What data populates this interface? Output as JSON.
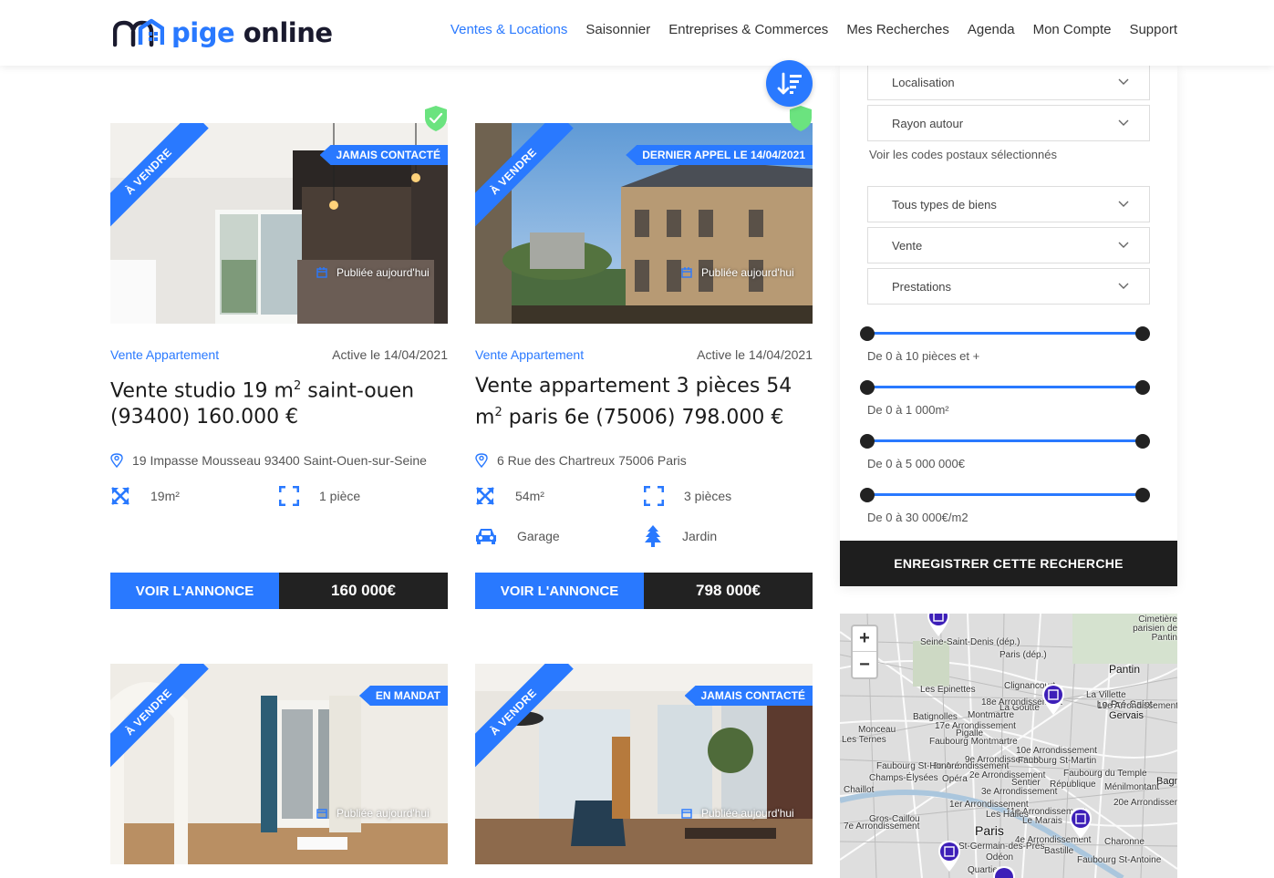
{
  "brand": {
    "part1": "pige",
    "part2": "online"
  },
  "nav": {
    "items": [
      {
        "label": "Ventes & Locations",
        "active": true
      },
      {
        "label": "Saisonnier"
      },
      {
        "label": "Entreprises & Commerces"
      },
      {
        "label": "Mes Recherches"
      },
      {
        "label": "Agenda"
      },
      {
        "label": "Mon Compte"
      },
      {
        "label": "Support"
      }
    ]
  },
  "colors": {
    "accent": "#2979ff",
    "dark": "#222222",
    "shield": "#6be37f"
  },
  "listings": [
    {
      "ribbon": "À VENDRE",
      "status": "JAMAIS CONTACTÉ",
      "published": "Publiée aujourd'hui",
      "type": "Vente Appartement",
      "active": "Active le 14/04/2021",
      "title_a": "Vente studio 19 m",
      "title_sup": "2",
      "title_b": " saint-ouen (93400) 160.000 €",
      "address": "19 Impasse Mousseau 93400 Saint-Ouen-sur-Seine",
      "surface": "19m²",
      "rooms": "1 pièce",
      "voir": "VOIR L'ANNONCE",
      "price": "160 000€"
    },
    {
      "ribbon": "À VENDRE",
      "status": "DERNIER APPEL LE 14/04/2021",
      "published": "Publiée aujourd'hui",
      "type": "Vente Appartement",
      "active": "Active le 14/04/2021",
      "title_a": "Vente appartement 3 pièces 54 m",
      "title_sup": "2",
      "title_b": " paris 6e (75006) 798.000 €",
      "address": "6 Rue des Chartreux 75006 Paris",
      "surface": "54m²",
      "rooms": "3 pièces",
      "garage": "Garage",
      "garden": "Jardin",
      "voir": "VOIR L'ANNONCE",
      "price": "798 000€"
    },
    {
      "ribbon": "À VENDRE",
      "status": "EN MANDAT",
      "published": "Publiée aujourd'hui"
    },
    {
      "ribbon": "À VENDRE",
      "status": "JAMAIS CONTACTÉ",
      "published": "Publiée aujourd'hui"
    }
  ],
  "sidebar": {
    "localisation": "Localisation",
    "rayon": "Rayon autour",
    "codes_link": "Voir les codes postaux sélectionnés",
    "types": "Tous types de biens",
    "transaction": "Vente",
    "prestations": "Prestations",
    "ranges": [
      {
        "label": "De 0 à 10 pièces et +",
        "min": 0,
        "max": 1
      },
      {
        "label": "De 0 à 1 000m²",
        "min": 0,
        "max": 1
      },
      {
        "label": "De 0 à 5 000 000€",
        "min": 0,
        "max": 1
      },
      {
        "label": "De 0 à 30 000€/m2",
        "min": 0,
        "max": 1
      }
    ],
    "save": "ENREGISTRER CETTE RECHERCHE"
  },
  "map": {
    "zoom_in": "+",
    "zoom_out": "−",
    "labels": {
      "saint_denis": "Seine-Saint-Denis (dép.)",
      "paris_dep": "Paris (dép.)",
      "cimetiere": "Cimetière parisien de Pantin",
      "pantin": "Pantin",
      "pre_st_gervais": "Le Pré-Saint-Gervais",
      "paris": "Paris",
      "bagnolet": "Bagnol",
      "epinettes": "Les Epinettes",
      "batignolles": "Batignolles",
      "montmartre": "Montmartre",
      "pigalle": "Pigalle",
      "monceau": "Monceau",
      "ternes": "Les Ternes",
      "champs": "Champs-Élysées",
      "opera": "Opéra",
      "chaillot": "Chaillot",
      "gros_caillou": "Gros-Caillou",
      "le_marais": "Le Marais",
      "villette": "La Villette",
      "goutte": "La Goutte",
      "clignancourt": "Clignancourt",
      "arr19": "19e Arrondissement",
      "arr18": "18e Arrondissement",
      "arr17": "17e Arrondissement",
      "arr10": "10e Arrondissement",
      "arr9": "9e Arrondissement",
      "arr8": "8e Arrondissement",
      "arr2": "2e Arrondissement",
      "arr3": "3e Arrondissement",
      "arr1": "1er Arrondissement",
      "arr4": "4e Arrondissement",
      "arr7": "7e Arrondissement",
      "arr11": "11e Arrondissement",
      "arr20": "20e Arrondissement",
      "faubourg_martin": "Faubourg St-Martin",
      "faubourg_temple": "Faubourg du Temple",
      "faubourg_montmartre": "Faubourg Montmartre",
      "faubourg_honore": "Faubourg St-Honoré",
      "faubourg_antoine": "Faubourg St-Antoine",
      "menilmontant": "Ménilmontant",
      "republique": "République",
      "sentier": "Sentier",
      "halles": "Les Halles",
      "charonne": "Charonne",
      "bastille": "Bastille",
      "st_germain": "St-Germain-des-Prés",
      "odeon": "Odéon",
      "quartier": "Quartier"
    }
  }
}
